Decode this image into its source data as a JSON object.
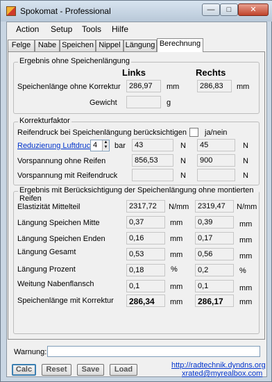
{
  "window": {
    "title": "Spokomat - Professional",
    "minimize_glyph": "—",
    "maximize_glyph": "□",
    "close_glyph": "✕",
    "icon": "app-icon"
  },
  "menu": [
    "Action",
    "Setup",
    "Tools",
    "Hilfe"
  ],
  "tabs": [
    "Felge",
    "Nabe",
    "Speichen",
    "Nippel",
    "Längung",
    "Berechnung"
  ],
  "active_tab": "Berechnung",
  "group1": {
    "title": "Ergebnis ohne Speichenlängung",
    "col_left": "Links",
    "col_right": "Rechts",
    "row1_label": "Speichenlänge ohne Korrektur",
    "row1_left": "286,97",
    "row1_right": "286,83",
    "unit_mm": "mm",
    "row2_label": "Gewicht",
    "row2_left": "",
    "unit_g": "g"
  },
  "group2": {
    "title": "Korrekturfaktor",
    "row1_label": "Reifendruck bei Speichenlängung berücksichtigen",
    "checkbox_label": "ja/nein",
    "reduction_label": "Reduzierung Luftdruck",
    "reduction_value": "4",
    "bar_unit": "bar",
    "reduction_left": "43",
    "reduction_right": "45",
    "unit_N": "N",
    "row3_label": "Vorspannung ohne Reifen",
    "row3_left": "856,53",
    "row3_right": "900",
    "row4_label": "Vorspannung mit Reifendruck",
    "row4_left": "",
    "row4_right": ""
  },
  "group3": {
    "title": "Ergebnis mit Berücksichtigung der Speichenlängung ohne montierten Reifen",
    "rows": [
      {
        "label": "Elastizität Mittelteil",
        "left": "2317,72",
        "unit_left": "N/mm",
        "right": "2319,47",
        "unit_right": "N/mm"
      },
      {
        "label": "Längung Speichen Mitte",
        "left": "0,37",
        "unit_left": "mm",
        "right": "0,39",
        "unit_right": "mm"
      },
      {
        "label": "Längung Speichen Enden",
        "left": "0,16",
        "unit_left": "mm",
        "right": "0,17",
        "unit_right": "mm"
      },
      {
        "label": "Längung Gesamt",
        "left": "0,53",
        "unit_left": "mm",
        "right": "0,56",
        "unit_right": "mm"
      },
      {
        "label": "Längung Prozent",
        "left": "0,18",
        "unit_left": "%",
        "right": "0,2",
        "unit_right": "%"
      },
      {
        "label": "Weitung Nabenflansch",
        "left": "0,1",
        "unit_left": "mm",
        "right": "0,1",
        "unit_right": "mm"
      },
      {
        "label": "Speichenlänge mit Korrektur",
        "left": "286,34",
        "unit_left": "mm",
        "right": "286,17",
        "unit_right": "mm"
      }
    ]
  },
  "status": {
    "warning_label": "Warnung:",
    "warning_value": ""
  },
  "buttons": {
    "calc": "Calc",
    "reset": "Reset",
    "save": "Save",
    "load": "Load"
  },
  "links": {
    "url": "http://radtechnik.dyndns.org",
    "email": "xrated@myrealbox.com"
  }
}
